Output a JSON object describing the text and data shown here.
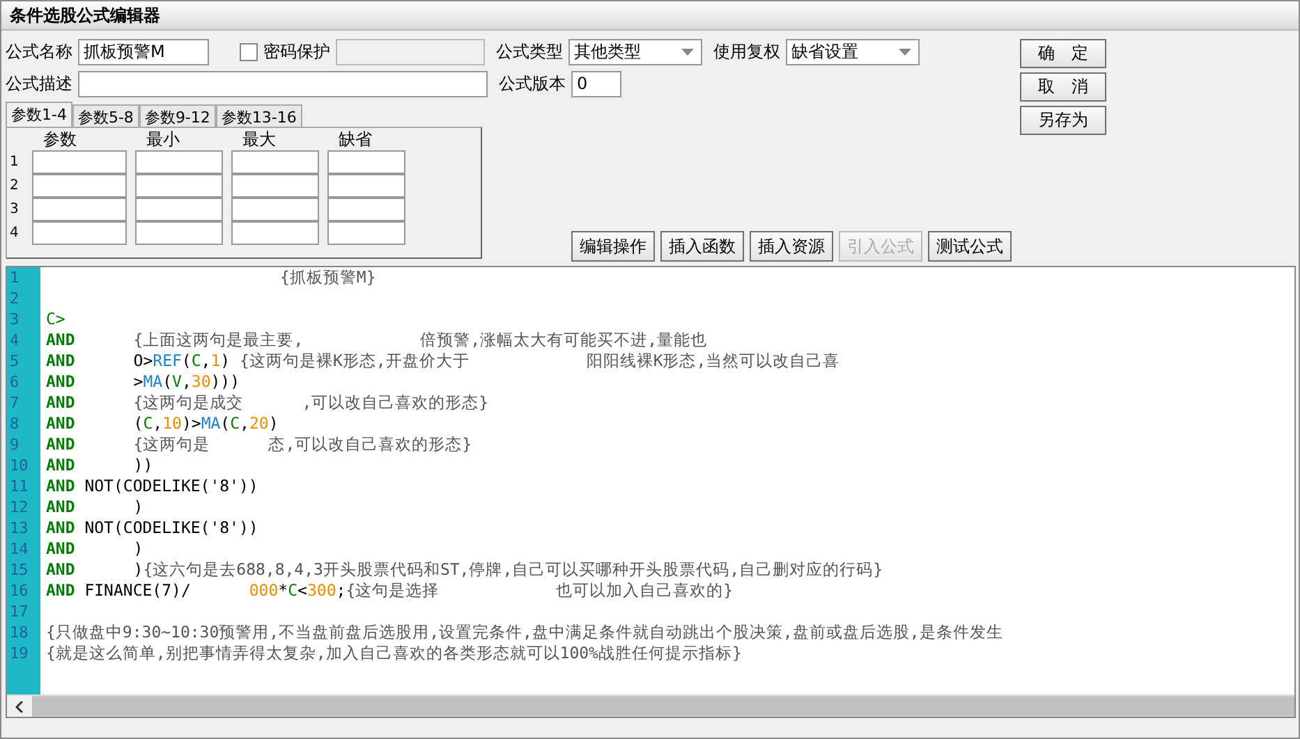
{
  "window": {
    "title": "条件选股公式编辑器"
  },
  "form": {
    "name": {
      "label": "公式名称",
      "value": "抓板预警M"
    },
    "password": {
      "label": "密码保护",
      "checked": false
    },
    "type": {
      "label": "公式类型",
      "value": "其他类型"
    },
    "adjust": {
      "label": "使用复权",
      "value": "缺省设置"
    },
    "description": {
      "label": "公式描述"
    },
    "version": {
      "label": "公式版本",
      "value": "0"
    }
  },
  "side_buttons": [
    {
      "label": "确　定",
      "disabled": false
    },
    {
      "label": "取　消",
      "disabled": false
    },
    {
      "label": "另存为",
      "disabled": false
    }
  ],
  "param_tabs": [
    {
      "label": "参数1-4",
      "selected": true
    },
    {
      "label": "参数5-8",
      "selected": false
    },
    {
      "label": "参数9-12",
      "selected": false
    },
    {
      "label": "参数13-16",
      "selected": false
    }
  ],
  "params": {
    "columns": [
      "参数",
      "最小",
      "最大",
      "缺省"
    ],
    "rows": [
      "1",
      "2",
      "3",
      "4"
    ]
  },
  "toolbar_buttons": [
    {
      "label": "编辑操作",
      "disabled": false
    },
    {
      "label": "插入函数",
      "disabled": false
    },
    {
      "label": "插入资源",
      "disabled": false
    },
    {
      "label": "引入公式",
      "disabled": true
    },
    {
      "label": "测试公式",
      "disabled": false
    }
  ],
  "editor": {
    "lines": [
      {
        "number": "1",
        "segments": [
          {
            "kind": "gap"
          },
          {
            "kind": "gap"
          },
          {
            "kind": "gap"
          },
          {
            "kind": "gap"
          },
          {
            "kind": "comment",
            "text": "{抓板预警M}"
          }
        ]
      },
      {
        "number": "2"
      },
      {
        "number": "3",
        "segments": [
          {
            "kind": "variable",
            "text": "C>"
          }
        ]
      },
      {
        "number": "4",
        "segments": [
          {
            "kind": "keyword",
            "text": "AND"
          },
          {
            "kind": "gap"
          },
          {
            "kind": "comment",
            "text": "{上面这两句是最主要,"
          },
          {
            "kind": "gap"
          },
          {
            "kind": "gap"
          },
          {
            "kind": "comment",
            "text": "倍预警,涨幅太大有可能买不进,量能也"
          }
        ]
      },
      {
        "number": "5",
        "segments": [
          {
            "kind": "keyword",
            "text": "AND"
          },
          {
            "kind": "gap"
          },
          {
            "kind": "operator",
            "text": "O>"
          },
          {
            "kind": "function",
            "text": "REF"
          },
          {
            "kind": "operator",
            "text": "("
          },
          {
            "kind": "variable",
            "text": "C"
          },
          {
            "kind": "operator",
            "text": ","
          },
          {
            "kind": "number",
            "text": "1"
          },
          {
            "kind": "operator",
            "text": ") "
          },
          {
            "kind": "comment",
            "text": "{这两句是裸K形态,开盘价大于"
          },
          {
            "kind": "gap"
          },
          {
            "kind": "gap"
          },
          {
            "kind": "comment",
            "text": "阳阳线裸K形态,当然可以改自己喜"
          }
        ]
      },
      {
        "number": "6",
        "segments": [
          {
            "kind": "keyword",
            "text": "AND"
          },
          {
            "kind": "gap"
          },
          {
            "kind": "operator",
            "text": ">"
          },
          {
            "kind": "function",
            "text": "MA"
          },
          {
            "kind": "operator",
            "text": "("
          },
          {
            "kind": "variable",
            "text": "V"
          },
          {
            "kind": "operator",
            "text": ","
          },
          {
            "kind": "number",
            "text": "30"
          },
          {
            "kind": "operator",
            "text": ")))"
          }
        ]
      },
      {
        "number": "7",
        "segments": [
          {
            "kind": "keyword",
            "text": "AND"
          },
          {
            "kind": "gap"
          },
          {
            "kind": "comment",
            "text": "{这两句是成交"
          },
          {
            "kind": "gap"
          },
          {
            "kind": "comment",
            "text": ",可以改自己喜欢的形态}"
          }
        ]
      },
      {
        "number": "8",
        "segments": [
          {
            "kind": "keyword",
            "text": "AND"
          },
          {
            "kind": "gap"
          },
          {
            "kind": "operator",
            "text": "("
          },
          {
            "kind": "variable",
            "text": "C"
          },
          {
            "kind": "operator",
            "text": ","
          },
          {
            "kind": "number",
            "text": "10"
          },
          {
            "kind": "operator",
            "text": ")>"
          },
          {
            "kind": "function",
            "text": "MA"
          },
          {
            "kind": "operator",
            "text": "("
          },
          {
            "kind": "variable",
            "text": "C"
          },
          {
            "kind": "operator",
            "text": ","
          },
          {
            "kind": "number",
            "text": "20"
          },
          {
            "kind": "operator",
            "text": ")"
          }
        ]
      },
      {
        "number": "9",
        "segments": [
          {
            "kind": "keyword",
            "text": "AND"
          },
          {
            "kind": "gap"
          },
          {
            "kind": "comment",
            "text": "{这两句是"
          },
          {
            "kind": "gap"
          },
          {
            "kind": "comment",
            "text": "态,可以改自己喜欢的形态}"
          }
        ]
      },
      {
        "number": "10",
        "segments": [
          {
            "kind": "keyword",
            "text": "AND"
          },
          {
            "kind": "gap"
          },
          {
            "kind": "operator",
            "text": "))"
          }
        ]
      },
      {
        "number": "11",
        "segments": [
          {
            "kind": "keyword",
            "text": "AND"
          },
          {
            "kind": "operator",
            "text": " NOT(CODELIKE('8'))"
          }
        ]
      },
      {
        "number": "12",
        "segments": [
          {
            "kind": "keyword",
            "text": "AND"
          },
          {
            "kind": "gap"
          },
          {
            "kind": "operator",
            "text": ")"
          }
        ]
      },
      {
        "number": "13",
        "segments": [
          {
            "kind": "keyword",
            "text": "AND"
          },
          {
            "kind": "operator",
            "text": " NOT(CODELIKE('8'))"
          }
        ]
      },
      {
        "number": "14",
        "segments": [
          {
            "kind": "keyword",
            "text": "AND"
          },
          {
            "kind": "gap"
          },
          {
            "kind": "operator",
            "text": ")"
          }
        ]
      },
      {
        "number": "15",
        "segments": [
          {
            "kind": "keyword",
            "text": "AND"
          },
          {
            "kind": "gap"
          },
          {
            "kind": "operator",
            "text": ")"
          },
          {
            "kind": "comment",
            "text": "{这六句是去688,8,4,3开头股票代码和ST,停牌,自己可以买哪种开头股票代码,自己删对应的行码}"
          }
        ]
      },
      {
        "number": "16",
        "segments": [
          {
            "kind": "keyword",
            "text": "AND"
          },
          {
            "kind": "operator",
            "text": " FINANCE(7)/"
          },
          {
            "kind": "gap"
          },
          {
            "kind": "number",
            "text": "000"
          },
          {
            "kind": "operator",
            "text": "*"
          },
          {
            "kind": "variable",
            "text": "C"
          },
          {
            "kind": "operator",
            "text": "<"
          },
          {
            "kind": "number",
            "text": "300"
          },
          {
            "kind": "operator",
            "text": ";"
          },
          {
            "kind": "comment",
            "text": "{这句是选择"
          },
          {
            "kind": "gap"
          },
          {
            "kind": "gap"
          },
          {
            "kind": "comment",
            "text": "也可以加入自己喜欢的}"
          }
        ]
      },
      {
        "number": "17"
      },
      {
        "number": "18",
        "segments": [
          {
            "kind": "comment",
            "text": "{只做盘中9:30~10:30预警用,不当盘前盘后选股用,设置完条件,盘中满足条件就自动跳出个股决策,盘前或盘后选股,是条件发生"
          }
        ]
      },
      {
        "number": "19",
        "segments": [
          {
            "kind": "comment",
            "text": "{就是这么简单,别把事情弄得太复杂,加入自己喜欢的各类形态就可以100%战胜任何提示指标}"
          }
        ]
      }
    ]
  }
}
